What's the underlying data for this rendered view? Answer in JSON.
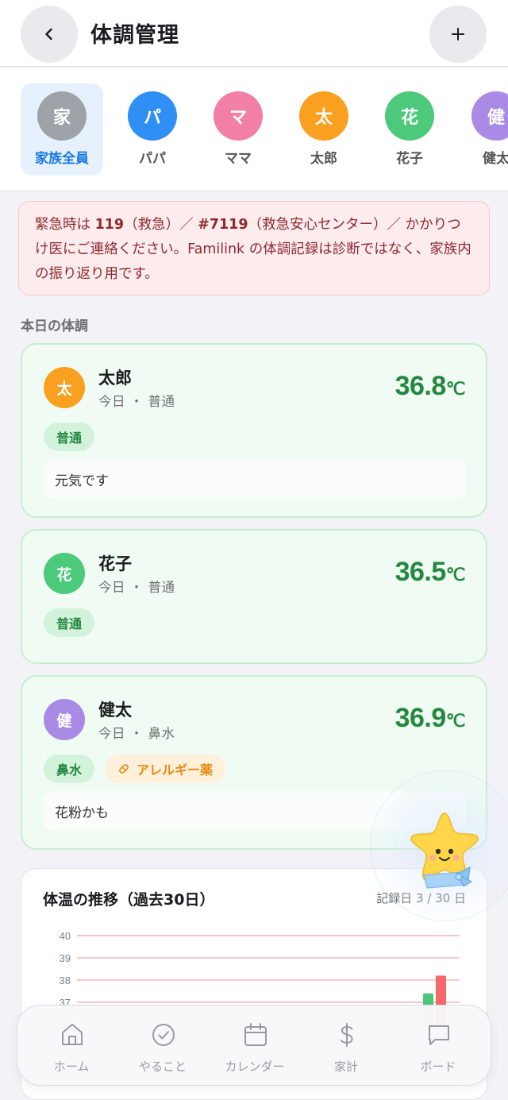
{
  "header": {
    "title": "体調管理",
    "back_icon": "chevron-left-icon",
    "add_icon": "plus-icon"
  },
  "members": [
    {
      "initial": "家",
      "name": "家族全員",
      "color": "#9ea3aa",
      "active": true
    },
    {
      "initial": "パ",
      "name": "パパ",
      "color": "#2f8ff5",
      "active": false
    },
    {
      "initial": "マ",
      "name": "ママ",
      "color": "#f27fa6",
      "active": false
    },
    {
      "initial": "太",
      "name": "太郎",
      "color": "#f9a021",
      "active": false
    },
    {
      "initial": "花",
      "name": "花子",
      "color": "#4cc97a",
      "active": false
    },
    {
      "initial": "健",
      "name": "健太",
      "color": "#a98be6",
      "active": false
    }
  ],
  "alert": {
    "p1": "緊急時は ",
    "b1": "119",
    "p2": "（救急）／ ",
    "b2": "#7119",
    "p3": "（救急安心センター）／ かかりつけ医にご連絡ください。Familink の体調記録は診断ではなく、家族内の振り返り用です。"
  },
  "section_title": "本日の体調",
  "records": [
    {
      "initial": "太",
      "name": "太郎",
      "subtitle": "今日 ・ 普通",
      "temp": "36.8",
      "unit": "℃",
      "tags": [
        "普通"
      ],
      "memo": "元気です",
      "color": "#f9a021"
    },
    {
      "initial": "花",
      "name": "花子",
      "subtitle": "今日 ・ 普通",
      "temp": "36.5",
      "unit": "℃",
      "tags": [
        "普通"
      ],
      "memo": "",
      "color": "#4cc97a"
    },
    {
      "initial": "健",
      "name": "健太",
      "subtitle": "今日 ・ 鼻水",
      "temp": "36.9",
      "unit": "℃",
      "tags": [
        "鼻水"
      ],
      "medicine": "アレルギー薬",
      "memo": "花粉かも",
      "color": "#a98be6"
    }
  ],
  "chart": {
    "title": "体温の推移（過去30日）",
    "meta": "記録日 3 / 30 日"
  },
  "chart_data": {
    "type": "bar",
    "title": "体温の推移（過去30日）",
    "ylim": [
      37,
      40
    ],
    "y_ticks": [
      "40",
      "39",
      "38",
      "37"
    ],
    "series": [
      {
        "values": [
          37.4
        ],
        "color": "#4cc97a"
      },
      {
        "values": [
          38.2
        ],
        "color": "#f5696b"
      }
    ],
    "grid": true
  },
  "nav": [
    {
      "label": "ホーム",
      "icon": "home-icon"
    },
    {
      "label": "やること",
      "icon": "check-circle-icon"
    },
    {
      "label": "カレンダー",
      "icon": "calendar-icon"
    },
    {
      "label": "家計",
      "icon": "dollar-icon"
    },
    {
      "label": "ボード",
      "icon": "chat-bubble-icon"
    }
  ]
}
